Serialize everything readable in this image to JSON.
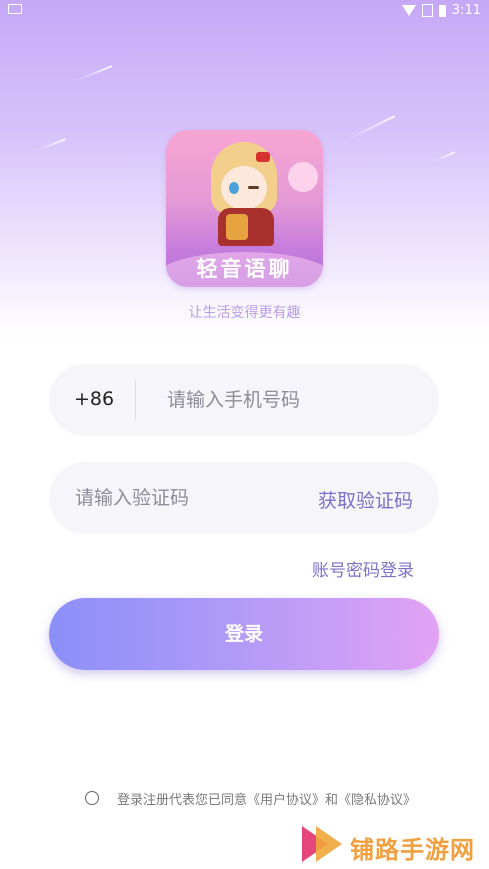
{
  "status_bar": {
    "time": "3:11"
  },
  "logo": {
    "app_name": "轻音语聊"
  },
  "tagline": "让生活变得更有趣",
  "phone_field": {
    "country_code": "+86",
    "placeholder": "请输入手机号码"
  },
  "code_field": {
    "placeholder": "请输入验证码",
    "get_code_label": "获取验证码"
  },
  "password_login_link": "账号密码登录",
  "login_button": "登录",
  "agreement": {
    "prefix": "登录注册代表您已同意",
    "user_agreement": "《用户协议》",
    "connector": "和",
    "privacy_agreement": "《隐私协议》"
  },
  "watermark": "铺路手游网",
  "colors": {
    "accent": "#7b71c8",
    "button_gradient_start": "#8b8ff8",
    "button_gradient_end": "#e2a2f4",
    "tagline": "#b89ee6"
  },
  "icons": [
    "menu-icon",
    "wifi-icon",
    "sim-card-icon",
    "battery-icon",
    "radio-button-icon",
    "watermark-logo-icon"
  ]
}
